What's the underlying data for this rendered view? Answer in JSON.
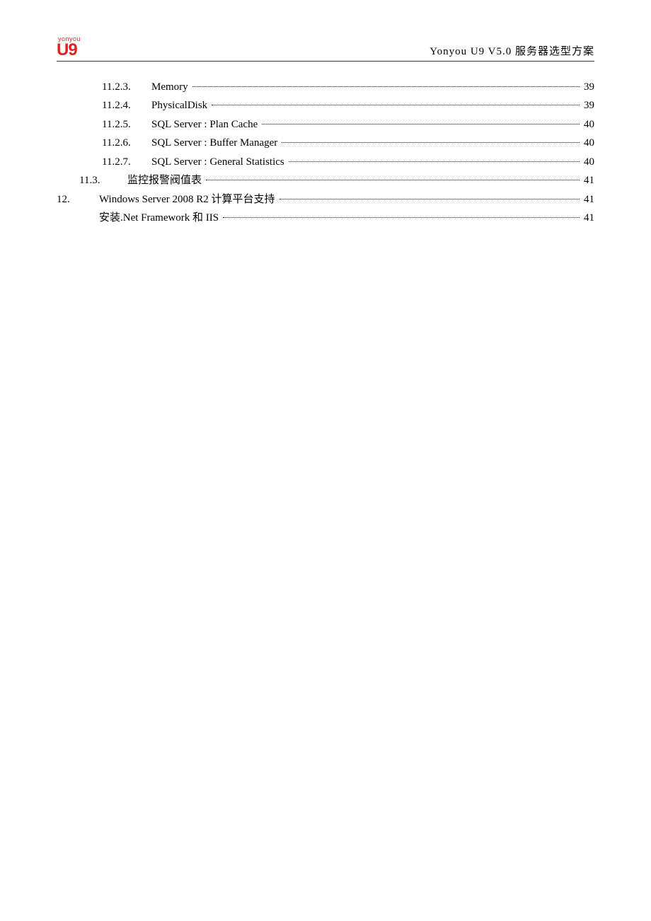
{
  "header": {
    "logo_top": "yonyou",
    "logo_main": "U9",
    "title": "Yonyou U9 V5.0 服务器选型方案"
  },
  "toc": [
    {
      "level": "l3",
      "num": "11.2.3.",
      "title": "Memory",
      "page": "39"
    },
    {
      "level": "l3",
      "num": "11.2.4.",
      "title": "PhysicalDisk",
      "page": "39"
    },
    {
      "level": "l3",
      "num": "11.2.5.",
      "title": "SQL Server : Plan Cache",
      "page": "40"
    },
    {
      "level": "l3",
      "num": "11.2.6.",
      "title": "SQL Server : Buffer Manager",
      "page": "40"
    },
    {
      "level": "l3",
      "num": "11.2.7.",
      "title": "SQL Server : General Statistics",
      "page": "40"
    },
    {
      "level": "l2",
      "num": "11.3.",
      "title": "监控报警阀值表",
      "page": "41"
    },
    {
      "level": "l1",
      "num": "12.",
      "title": "Windows Server 2008 R2  计算平台支持",
      "page": "41"
    },
    {
      "level": "l2b",
      "num": "",
      "title": "安装.Net Framework 和 IIS",
      "page": "41"
    }
  ]
}
